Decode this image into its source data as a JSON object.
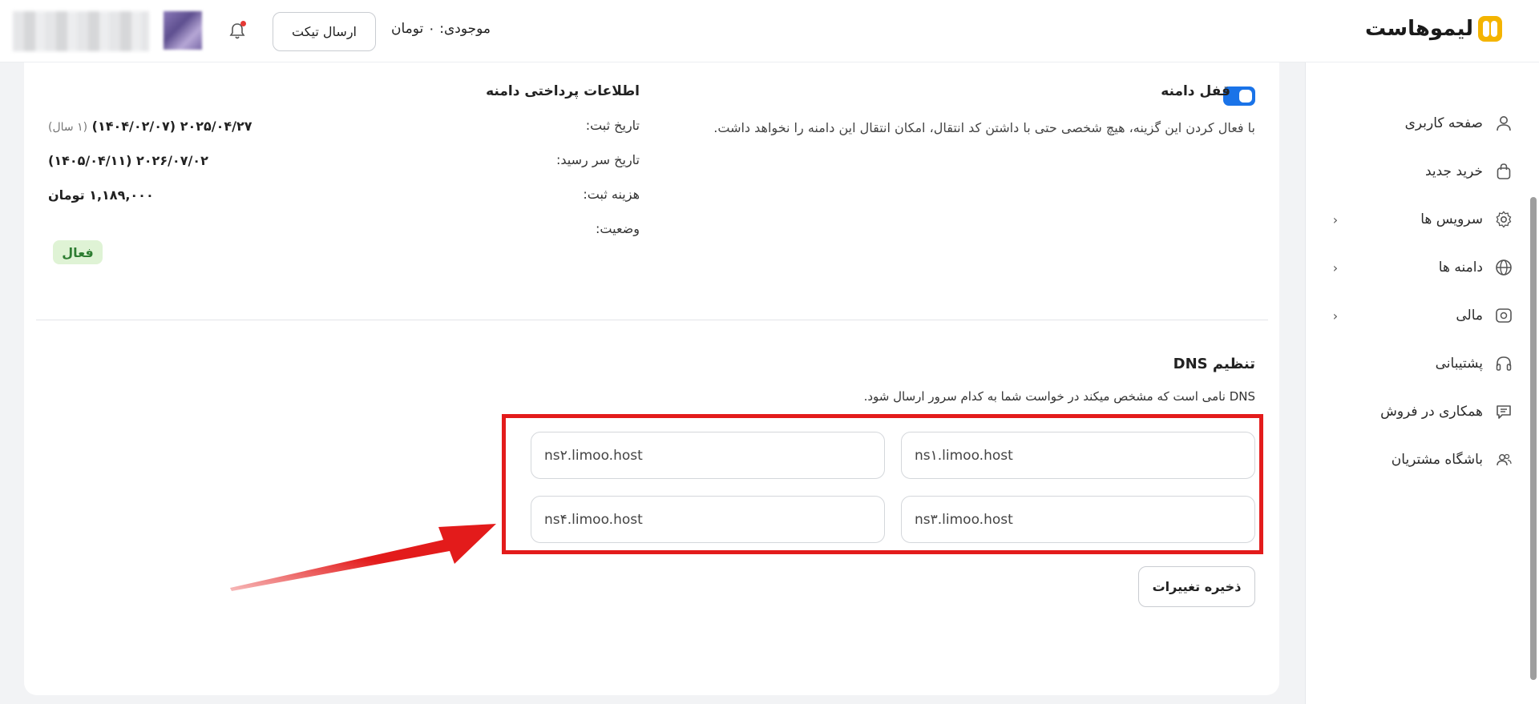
{
  "brand": {
    "logo_text": "لیموهاست"
  },
  "header": {
    "balance_text": "موجودی: ۰ تومان",
    "send_ticket_label": "ارسال تیکت"
  },
  "sidebar": {
    "items": [
      {
        "label": "صفحه کاربری",
        "icon": "user-icon",
        "has_submenu": false
      },
      {
        "label": "خرید جدید",
        "icon": "shopping-bag-icon",
        "has_submenu": false
      },
      {
        "label": "سرویس ها",
        "icon": "gear-icon",
        "has_submenu": true
      },
      {
        "label": "دامنه ها",
        "icon": "globe-icon",
        "has_submenu": true
      },
      {
        "label": "مالی",
        "icon": "money-icon",
        "has_submenu": true
      },
      {
        "label": "پشتیبانی",
        "icon": "headphones-icon",
        "has_submenu": false
      },
      {
        "label": "همکاری در فروش",
        "icon": "chat-icon",
        "has_submenu": false
      },
      {
        "label": "باشگاه مشتریان",
        "icon": "users-icon",
        "has_submenu": false
      }
    ]
  },
  "domain_lock": {
    "title": "قفل دامنه",
    "enabled": true,
    "description": "با فعال کردن این گزینه، هیچ شخصی حتی با داشتن کد انتقال، امکان انتقال این دامنه را نخواهد داشت."
  },
  "payment_info": {
    "title": "اطلاعات پرداختی دامنه",
    "registration_label": "تاریخ ثبت:",
    "registration_value": "۲۰۲۵/۰۴/۲۷ (۱۴۰۴/۰۲/۰۷)",
    "registration_period": "(۱ سال)",
    "due_label": "تاریخ سر رسید:",
    "due_value": "۲۰۲۶/۰۷/۰۲ (۱۴۰۵/۰۴/۱۱)",
    "cost_label": "هزینه ثبت:",
    "cost_value": "۱,۱۸۹,۰۰۰ تومان",
    "status_label": "وضعیت:",
    "status_value": "فعال"
  },
  "dns": {
    "title": "تنظیم DNS",
    "description": "DNS نامی است که مشخص میکند در خواست شما به کدام سرور ارسال شود.",
    "ns1": "ns۱.limoo.host",
    "ns2": "ns۲.limoo.host",
    "ns3": "ns۳.limoo.host",
    "ns4": "ns۴.limoo.host",
    "save_label": "ذخیره تغییرات"
  },
  "colors": {
    "accent": "#1a73e8",
    "highlight": "#e31b1b",
    "status_bg": "#dff3d5",
    "status_text": "#2e7d32",
    "brand": "#f4b400"
  }
}
